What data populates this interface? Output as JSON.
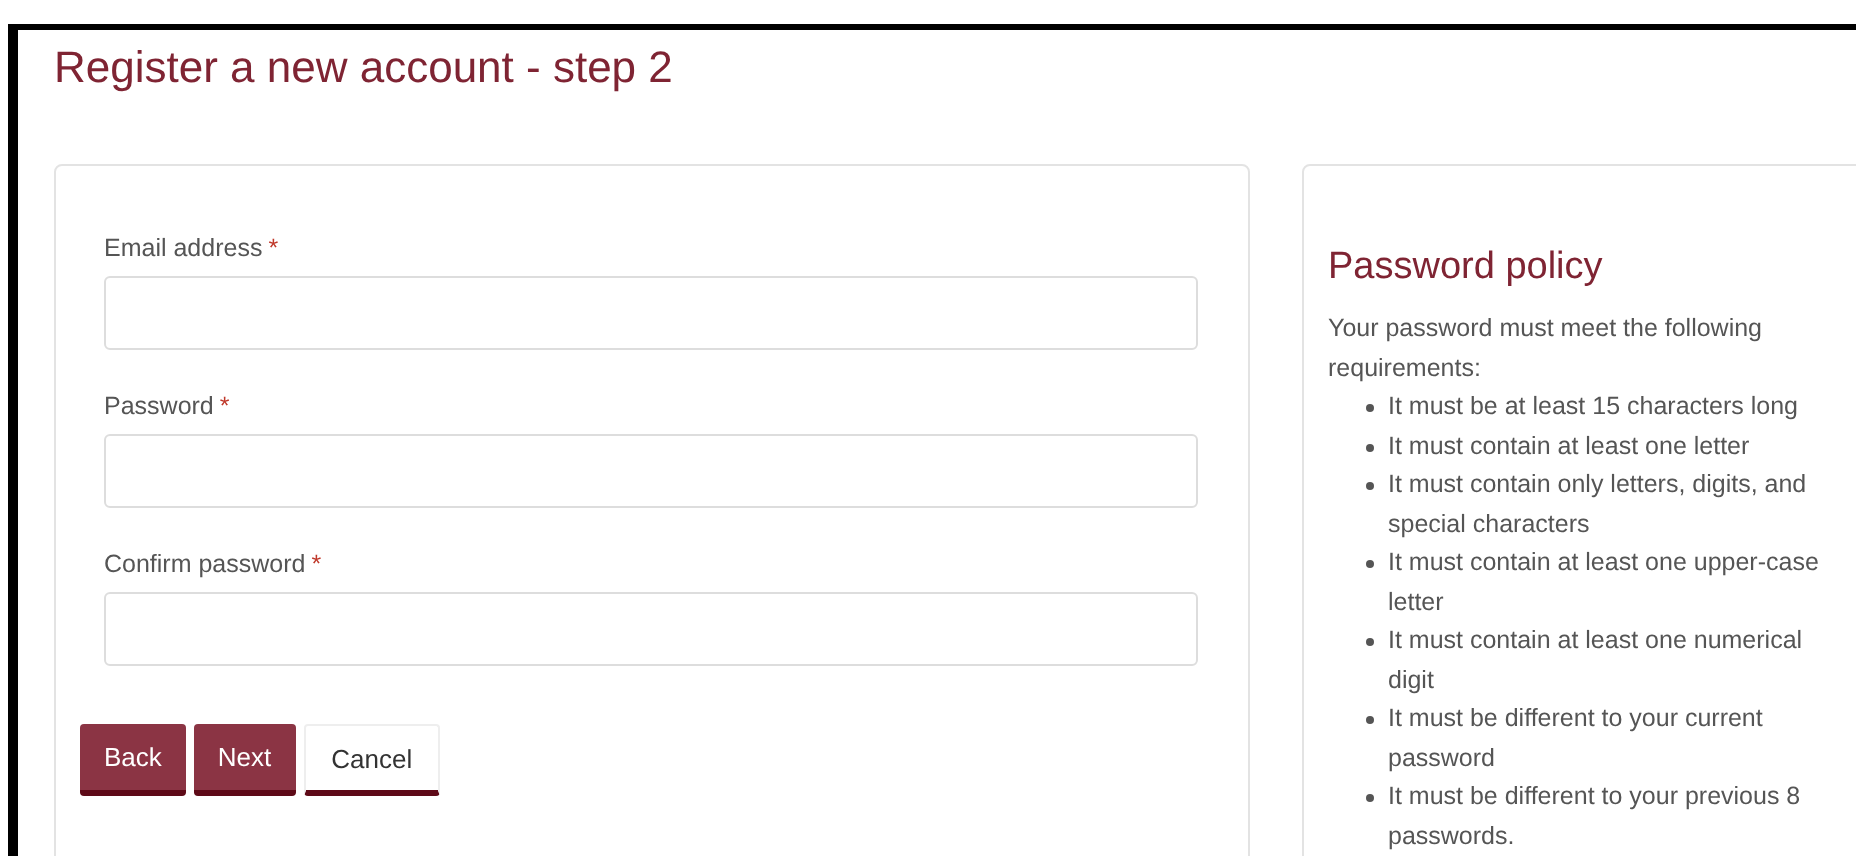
{
  "title": "Register a new account - step 2",
  "form": {
    "fields": [
      {
        "label": "Email address",
        "required_mark": "*"
      },
      {
        "label": "Password",
        "required_mark": "*"
      },
      {
        "label": "Confirm password",
        "required_mark": "*"
      }
    ],
    "buttons": [
      {
        "label": "Back",
        "kind": "primary"
      },
      {
        "label": "Next",
        "kind": "primary"
      },
      {
        "label": "Cancel",
        "kind": "secondary"
      }
    ]
  },
  "policy": {
    "heading": "Password policy",
    "intro": "Your password must meet the following requirements:",
    "rules": [
      "It must be at least 15 characters long",
      "It must contain at least one letter",
      "It must contain only letters, digits, and special characters",
      "It must contain at least one upper-case letter",
      "It must contain at least one numerical digit",
      "It must be different to your current password",
      "It must be different to your previous 8 passwords."
    ]
  }
}
